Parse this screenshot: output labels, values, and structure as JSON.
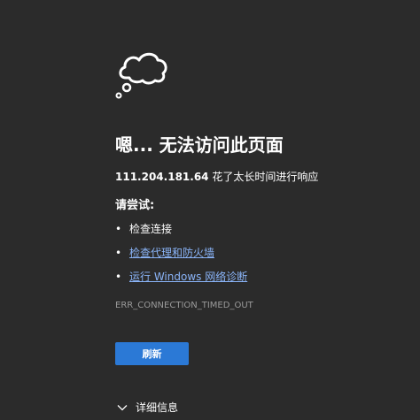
{
  "error_page": {
    "title": "嗯... 无法访问此页面",
    "message": {
      "host": "111.204.181.64",
      "text": " 花了太长时间进行响应"
    },
    "try_heading": "请尝试:",
    "suggestions": [
      {
        "bullet": "•",
        "label": "检查连接",
        "is_link": false
      },
      {
        "bullet": "•",
        "label": "检查代理和防火墙",
        "is_link": true
      },
      {
        "bullet": "•",
        "label": "运行 Windows 网络诊断",
        "is_link": true
      }
    ],
    "error_code": "ERR_CONNECTION_TIMED_OUT",
    "refresh_label": "刷新",
    "details_label": "详细信息",
    "icons": {
      "illustration": "cloud-icon",
      "details_toggle": "chevron-down-icon"
    },
    "colors": {
      "background": "#2b2b2b",
      "text": "#ffffff",
      "link": "#8ab4f8",
      "muted": "#9a9a9a",
      "accent": "#2b79d6"
    }
  }
}
